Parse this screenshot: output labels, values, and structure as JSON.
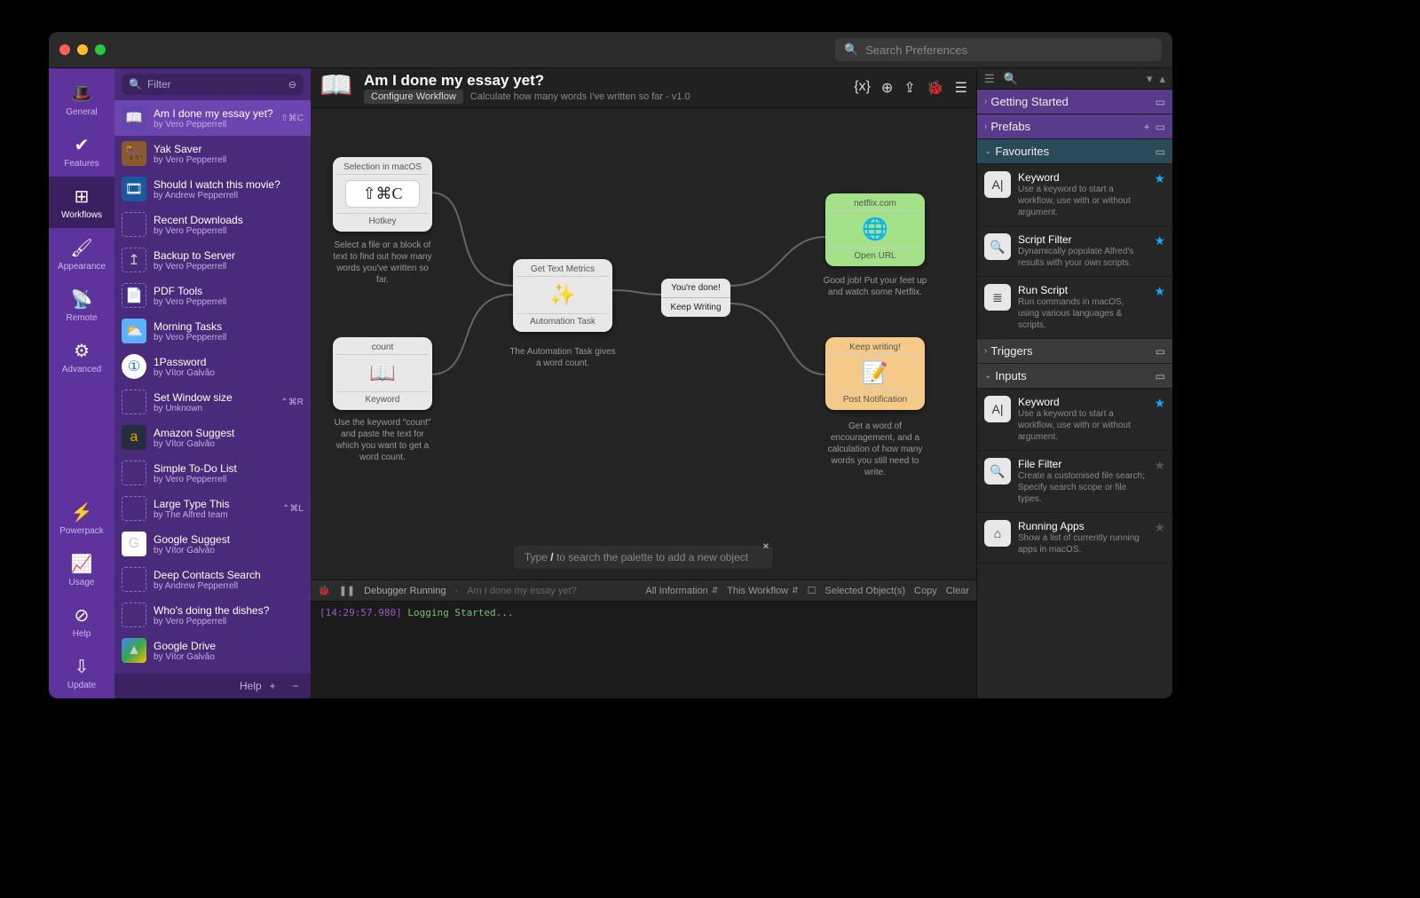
{
  "search": {
    "placeholder": "Search Preferences"
  },
  "nav": [
    {
      "icon": "🎩",
      "label": "General"
    },
    {
      "icon": "✔",
      "label": "Features"
    },
    {
      "icon": "⊞",
      "label": "Workflows"
    },
    {
      "icon": "🖌",
      "label": "Appearance"
    },
    {
      "icon": "📡",
      "label": "Remote"
    },
    {
      "icon": "⚙",
      "label": "Advanced"
    }
  ],
  "nav_bottom": [
    {
      "icon": "⚡",
      "label": "Powerpack"
    },
    {
      "icon": "📈",
      "label": "Usage"
    },
    {
      "icon": "⊘",
      "label": "Help"
    },
    {
      "icon": "⇩",
      "label": "Update"
    }
  ],
  "filter": {
    "placeholder": "Filter"
  },
  "workflows": [
    {
      "icon": "book",
      "ico": "📖",
      "name": "Am I done my essay yet?",
      "by": "by Vero Pepperrell",
      "short": "⇧⌘C",
      "sel": true
    },
    {
      "icon": "yak",
      "ico": "🐂",
      "name": "Yak Saver",
      "by": "by Vero Pepperrell"
    },
    {
      "icon": "film",
      "ico": "🎞",
      "name": "Should I watch this movie?",
      "by": "by Andrew Pepperrell"
    },
    {
      "icon": "blank",
      "ico": "",
      "name": "Recent Downloads",
      "by": "by Vero Pepperrell"
    },
    {
      "icon": "blank",
      "ico": "↥",
      "name": "Backup to Server",
      "by": "by Vero Pepperrell"
    },
    {
      "icon": "blank",
      "ico": "📄",
      "name": "PDF Tools",
      "by": "by Vero Pepperrell"
    },
    {
      "icon": "weather",
      "ico": "⛅",
      "name": "Morning Tasks",
      "by": "by Vero Pepperrell"
    },
    {
      "icon": "onep",
      "ico": "①",
      "name": "1Password",
      "by": "by Vítor Galvão"
    },
    {
      "icon": "blank",
      "ico": "",
      "name": "Set Window size",
      "by": "by Unknown",
      "short": "⌃⌘R"
    },
    {
      "icon": "az",
      "ico": "a",
      "name": "Amazon Suggest",
      "by": "by Vítor Galvão"
    },
    {
      "icon": "blank",
      "ico": "",
      "name": "Simple To-Do List",
      "by": "by Vero Pepperrell"
    },
    {
      "icon": "blank",
      "ico": "",
      "name": "Large Type This",
      "by": "by The Alfred team",
      "short": "⌃⌘L"
    },
    {
      "icon": "gg",
      "ico": "G",
      "name": "Google Suggest",
      "by": "by Vítor Galvão"
    },
    {
      "icon": "blank",
      "ico": "",
      "name": "Deep Contacts Search",
      "by": "by Andrew Pepperrell"
    },
    {
      "icon": "blank",
      "ico": "",
      "name": "Who's doing the dishes?",
      "by": "by Vero Pepperrell"
    },
    {
      "icon": "gd",
      "ico": "▲",
      "name": "Google Drive",
      "by": "by Vítor Galvão"
    }
  ],
  "list_footer": {
    "help": "Help",
    "plus": "+",
    "minus": "−"
  },
  "header": {
    "title": "Am I done my essay yet?",
    "configure": "Configure Workflow",
    "subtitle": "Calculate how many words I've written so far - v1.0"
  },
  "nodes": {
    "hotkey": {
      "top": "Selection in macOS",
      "combo": "⇧⌘C",
      "foot": "Hotkey",
      "desc": "Select a file or a block of text to find out how many words you've written so far."
    },
    "keyword": {
      "top": "count",
      "ico": "📖",
      "foot": "Keyword",
      "desc": "Use the keyword \"count\" and paste the text for which you want to get a word count."
    },
    "auto": {
      "top": "Get Text Metrics",
      "ico": "✨",
      "foot": "Automation Task",
      "desc": "The Automation Task gives a word count."
    },
    "cond": {
      "a": "You're done!",
      "b": "Keep Writing"
    },
    "url": {
      "top": "netflix.com",
      "ico": "🌐",
      "foot": "Open URL",
      "desc": "Good job! Put your feet up and watch some Netflix."
    },
    "notif": {
      "top": "Keep writing!",
      "ico": "📝",
      "foot": "Post Notification",
      "desc": "Get a word of encouragement, and a calculation of how many words you still need to write."
    }
  },
  "palette_prompt": {
    "pre": "Type ",
    "key": "/",
    "post": " to search the palette to add a new object"
  },
  "debugger": {
    "label": "Debugger Running",
    "context": "Am I done my essay yet?",
    "level": "All Information",
    "scope": "This Workflow",
    "selected": "Selected Object(s)",
    "copy": "Copy",
    "clear": "Clear"
  },
  "log": {
    "ts": "[14:29:57.980]",
    "msg": " Logging Started..."
  },
  "panel": {
    "sections": {
      "started": "Getting Started",
      "prefabs": "Prefabs",
      "favourites": "Favourites",
      "triggers": "Triggers",
      "inputs": "Inputs"
    },
    "fav": [
      {
        "ico": "A|",
        "name": "Keyword",
        "desc": "Use a keyword to start a workflow, use with or without argument.",
        "star": true
      },
      {
        "ico": "🔍",
        "name": "Script Filter",
        "desc": "Dynamically populate Alfred's results with your own scripts.",
        "star": true
      },
      {
        "ico": "≣",
        "name": "Run Script",
        "desc": "Run commands in macOS, using various languages & scripts.",
        "star": true
      }
    ],
    "inputs": [
      {
        "ico": "A|",
        "name": "Keyword",
        "desc": "Use a keyword to start a workflow, use with or without argument.",
        "star": true
      },
      {
        "ico": "🔍",
        "name": "File Filter",
        "desc": "Create a customised file search; Specify search scope or file types.",
        "star": false
      },
      {
        "ico": "⌂",
        "name": "Running Apps",
        "desc": "Show a list of currently running apps in macOS.",
        "star": false
      }
    ]
  }
}
